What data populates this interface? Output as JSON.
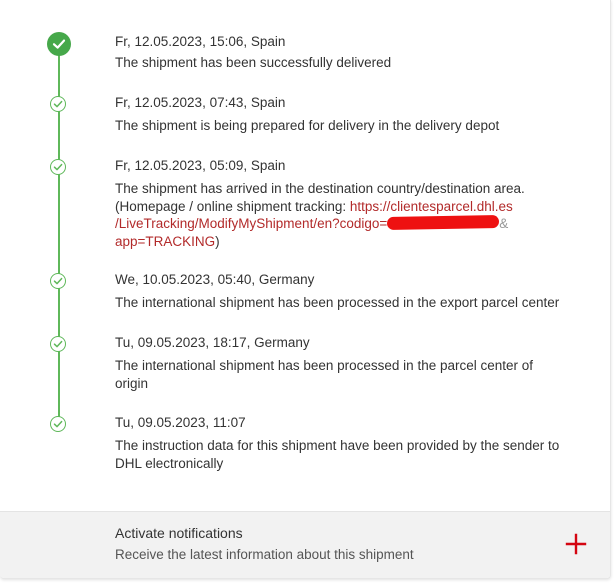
{
  "colors": {
    "timeline_green": "#5fb85a",
    "delivered_green": "#46a84a",
    "link_red": "#b22a2a",
    "plus_red": "#d40511",
    "redaction_red": "#ee1111"
  },
  "events": [
    {
      "icon": "check-filled-icon",
      "date": "Fr, 12.05.2023, 15:06, Spain",
      "text": "The shipment has been successfully delivered"
    },
    {
      "icon": "check-circle-icon",
      "date": "Fr, 12.05.2023, 07:43, Spain",
      "text": "The shipment is being prepared for delivery in the delivery depot"
    },
    {
      "icon": "check-circle-icon",
      "date": "Fr, 12.05.2023, 05:09, Spain",
      "text_line1": "The shipment has arrived in the destination country/destination area.",
      "text_prefix": "(Homepage / online shipment tracking: ",
      "link_part1": "https://clientesparcel.dhl.es",
      "link_part2": "/LiveTracking/ModifyMyShipment/en?codigo=",
      "link_part3": "&",
      "link_part4": "app=TRACKING",
      "text_suffix": ")"
    },
    {
      "icon": "check-circle-icon",
      "date": "We, 10.05.2023, 05:40, Germany",
      "text": "The international shipment has been processed in the export parcel center"
    },
    {
      "icon": "check-circle-icon",
      "date": "Tu, 09.05.2023, 18:17, Germany",
      "text": "The international shipment has been processed in the parcel center of origin"
    },
    {
      "icon": "check-circle-icon",
      "date": "Tu, 09.05.2023, 11:07",
      "text": "The instruction data for this shipment have been provided by the sender to DHL electronically"
    }
  ],
  "notifications": {
    "title": "Activate notifications",
    "subtitle": "Receive the latest information about this shipment",
    "icon": "plus-icon"
  }
}
